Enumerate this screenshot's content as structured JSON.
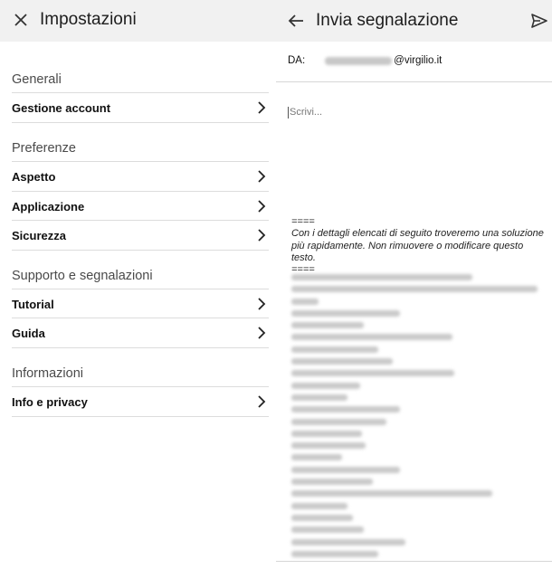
{
  "settings": {
    "title": "Impostazioni",
    "close_icon": "close-icon",
    "sections": [
      {
        "header": "Generali",
        "items": [
          "Gestione account"
        ]
      },
      {
        "header": "Preferenze",
        "items": [
          "Aspetto",
          "Applicazione",
          "Sicurezza"
        ]
      },
      {
        "header": "Supporto e segnalazioni",
        "items": [
          "Tutorial",
          "Guida"
        ]
      },
      {
        "header": "Informazioni",
        "items": [
          "Info e privacy"
        ]
      }
    ]
  },
  "report": {
    "title": "Invia segnalazione",
    "from_label": "DA:",
    "from_domain": "@virgilio.it",
    "compose_placeholder": "Scrivi...",
    "separator": "====",
    "signature_text": "Con i dettagli elencati di seguito troveremo una soluzione più rapidamente. Non rimuovere o modificare questo testo."
  }
}
